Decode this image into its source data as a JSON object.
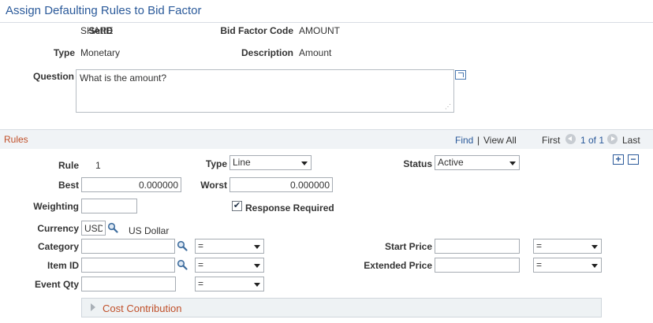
{
  "page": {
    "title": "Assign Defaulting Rules to Bid Factor"
  },
  "header": {
    "setid_label": "SetID",
    "setid_value": "SHARE",
    "bid_factor_code_label": "Bid Factor Code",
    "bid_factor_code_value": "AMOUNT",
    "type_label": "Type",
    "type_value": "Monetary",
    "description_label": "Description",
    "description_value": "Amount",
    "question_label": "Question",
    "question_value": "What is the amount?"
  },
  "rules": {
    "title": "Rules",
    "find_label": "Find",
    "separator": "|",
    "view_all_label": "View All",
    "first_label": "First",
    "count_text": "1 of 1",
    "last_label": "Last",
    "add_button": "+",
    "remove_button": "−"
  },
  "rule": {
    "rule_label": "Rule",
    "rule_value": "1",
    "type_label": "Type",
    "type_value": "Line",
    "status_label": "Status",
    "status_value": "Active",
    "best_label": "Best",
    "best_value": "0.000000",
    "worst_label": "Worst",
    "worst_value": "0.000000",
    "weighting_label": "Weighting",
    "weighting_value": "",
    "response_required_label": "Response Required",
    "response_required_checked": true,
    "currency_label": "Currency",
    "currency_value": "USD",
    "currency_description": "US Dollar",
    "category_label": "Category",
    "category_value": "",
    "category_operator": "=",
    "item_id_label": "Item ID",
    "item_id_value": "",
    "item_id_operator": "=",
    "event_qty_label": "Event Qty",
    "event_qty_value": "",
    "event_qty_operator": "=",
    "start_price_label": "Start Price",
    "start_price_value": "",
    "start_price_operator": "=",
    "extended_price_label": "Extended Price",
    "extended_price_value": "",
    "extended_price_operator": "="
  },
  "cost_contribution": {
    "label": "Cost Contribution"
  },
  "icons": {
    "expand": "expand-window-icon",
    "lookup": "magnifying-glass-icon",
    "prev": "previous-arrow-icon",
    "next": "next-arrow-icon",
    "collapse": "collapsed-triangle-icon"
  }
}
